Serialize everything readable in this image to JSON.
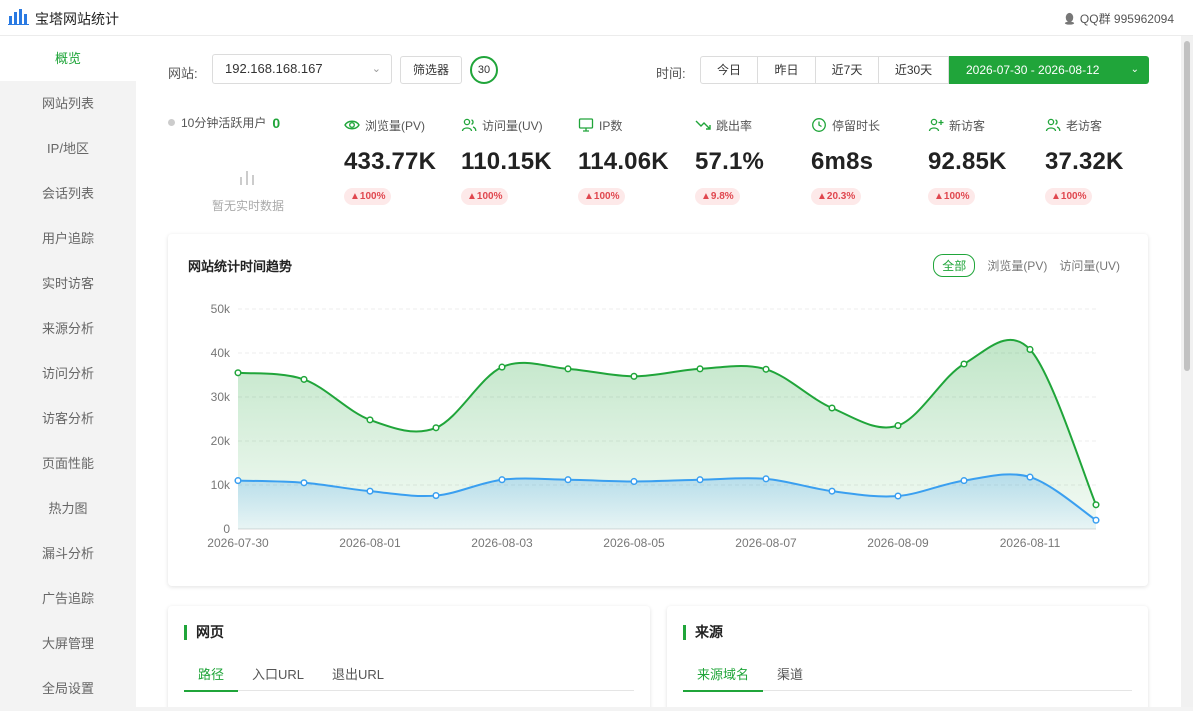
{
  "app": {
    "title": "宝塔网站统计",
    "qq_label": "QQ群 995962094"
  },
  "sidebar": {
    "items": [
      {
        "label": "概览",
        "active": true
      },
      {
        "label": "网站列表"
      },
      {
        "label": "IP/地区"
      },
      {
        "label": "会话列表"
      },
      {
        "label": "用户追踪"
      },
      {
        "label": "实时访客"
      },
      {
        "label": "来源分析"
      },
      {
        "label": "访问分析"
      },
      {
        "label": "访客分析"
      },
      {
        "label": "页面性能"
      },
      {
        "label": "热力图"
      },
      {
        "label": "漏斗分析"
      },
      {
        "label": "广告追踪"
      },
      {
        "label": "大屏管理"
      },
      {
        "label": "全局设置"
      }
    ]
  },
  "toolbar": {
    "site_label": "网站:",
    "site_value": "192.168.168.167",
    "filter_label": "筛选器",
    "filter_count": "30",
    "time_label": "时间:",
    "time_options": [
      "今日",
      "昨日",
      "近7天",
      "近30天"
    ],
    "date_range": "2026-07-30 - 2026-08-12"
  },
  "realtime": {
    "label": "10分钟活跃用户",
    "value": "0",
    "empty_text": "暂无实时数据"
  },
  "metrics": [
    {
      "label": "浏览量(PV)",
      "value": "433.77K",
      "change": "▲100%",
      "icon": "eye-icon"
    },
    {
      "label": "访问量(UV)",
      "value": "110.15K",
      "change": "▲100%",
      "icon": "users-icon"
    },
    {
      "label": "IP数",
      "value": "114.06K",
      "change": "▲100%",
      "icon": "monitor-icon"
    },
    {
      "label": "跳出率",
      "value": "57.1%",
      "change": "▲9.8%",
      "icon": "trend-down-icon"
    },
    {
      "label": "停留时长",
      "value": "6m8s",
      "change": "▲20.3%",
      "icon": "clock-icon"
    },
    {
      "label": "新访客",
      "value": "92.85K",
      "change": "▲100%",
      "icon": "user-plus-icon"
    },
    {
      "label": "老访客",
      "value": "37.32K",
      "change": "▲100%",
      "icon": "users-icon"
    }
  ],
  "trend": {
    "title": "网站统计时间趋势",
    "tabs": [
      "全部",
      "浏览量(PV)",
      "访问量(UV)"
    ]
  },
  "colors": {
    "accent": "#20a53a",
    "pv_line": "#20a53a",
    "uv_line": "#3a9ff0",
    "badge_text": "#e0474f"
  },
  "chart_data": {
    "type": "area",
    "title": "网站统计时间趋势",
    "x": [
      "2026-07-30",
      "2026-07-31",
      "2026-08-01",
      "2026-08-02",
      "2026-08-03",
      "2026-08-04",
      "2026-08-05",
      "2026-08-06",
      "2026-08-07",
      "2026-08-08",
      "2026-08-09",
      "2026-08-10",
      "2026-08-11",
      "2026-08-12"
    ],
    "x_tick_labels": [
      "2026-07-30",
      "2026-08-01",
      "2026-08-03",
      "2026-08-05",
      "2026-08-07",
      "2026-08-09",
      "2026-08-11"
    ],
    "y_tick_labels": [
      "0",
      "10k",
      "20k",
      "30k",
      "40k",
      "50k"
    ],
    "ylim": [
      0,
      50000
    ],
    "series": [
      {
        "name": "浏览量(PV)",
        "color": "#20a53a",
        "values": [
          35500,
          34000,
          24800,
          23000,
          36800,
          36400,
          34700,
          36400,
          36300,
          27500,
          23500,
          37500,
          40800,
          5500
        ]
      },
      {
        "name": "访问量(UV)",
        "color": "#3a9ff0",
        "values": [
          11000,
          10500,
          8600,
          7600,
          11200,
          11200,
          10800,
          11200,
          11400,
          8600,
          7500,
          11000,
          11800,
          2000
        ]
      }
    ],
    "grid": "horizontal dashed"
  },
  "cards": {
    "pages": {
      "title": "网页",
      "tabs": [
        "路径",
        "入口URL",
        "退出URL"
      ]
    },
    "sources": {
      "title": "来源",
      "tabs": [
        "来源域名",
        "渠道"
      ]
    }
  }
}
